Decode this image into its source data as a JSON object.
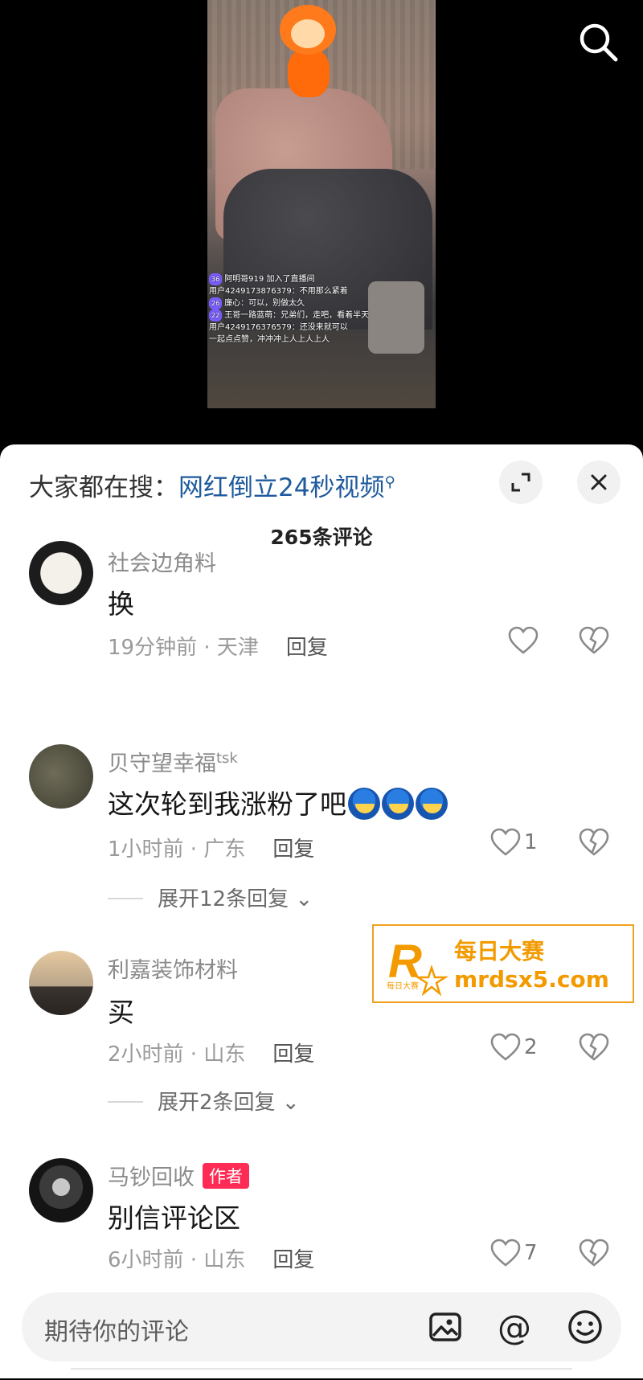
{
  "video": {
    "live_chat": [
      {
        "lv": "36",
        "text": "阿明哥919 加入了直播间"
      },
      {
        "lv": "",
        "text": "用户424917387637​9：不用那么紧着"
      },
      {
        "lv": "26",
        "text": "廉心：可以，别做太久"
      },
      {
        "lv": "22",
        "text": "王哥一路蓝萌：兄弟们，走吧，看着半天"
      },
      {
        "lv": "",
        "text": "用户4249176376579：还没来就可以"
      },
      {
        "lv": "",
        "text": "一起点点赞，冲冲冲上人上人上人"
      }
    ]
  },
  "hot_search": {
    "prefix": "大家都在搜：",
    "term": "网红倒立24秒视频",
    "suffix_icon": "search-mini-icon"
  },
  "comment_count": "265条评论",
  "comments": [
    {
      "user": "社会边角料",
      "user_sup": "",
      "badge": "",
      "text": "换",
      "emojis": 0,
      "time_loc": "19分钟前 · 天津",
      "reply": "回复",
      "likes": "",
      "expand": ""
    },
    {
      "user": "贝守望幸福",
      "user_sup": "tsk",
      "badge": "",
      "text": "这次轮到我涨粉了吧",
      "emojis": 3,
      "time_loc": "1小时前 · 广东",
      "reply": "回复",
      "likes": "1",
      "expand": "展开12条回复"
    },
    {
      "user": "利嘉装饰材料",
      "user_sup": "",
      "badge": "",
      "text": "买",
      "emojis": 0,
      "time_loc": "2小时前 · 山东",
      "reply": "回复",
      "likes": "2",
      "expand": "展开2条回复"
    },
    {
      "user": "马钞回收",
      "user_sup": "",
      "badge": "作者",
      "text": "别信评论区",
      "emojis": 0,
      "time_loc": "6小时前 · 山东",
      "reply": "回复",
      "likes": "7",
      "expand": ""
    }
  ],
  "watermark": {
    "cn": "每日大赛",
    "url": "mrdsx5.com",
    "small": "每日大赛"
  },
  "input": {
    "placeholder": "期待你的评论",
    "icons": [
      "image-icon",
      "at-icon",
      "emoji-icon"
    ]
  },
  "colors": {
    "link_blue": "#1e5a9c",
    "author_badge": "#fe2c55",
    "watermark_orange": "#f29a00"
  }
}
